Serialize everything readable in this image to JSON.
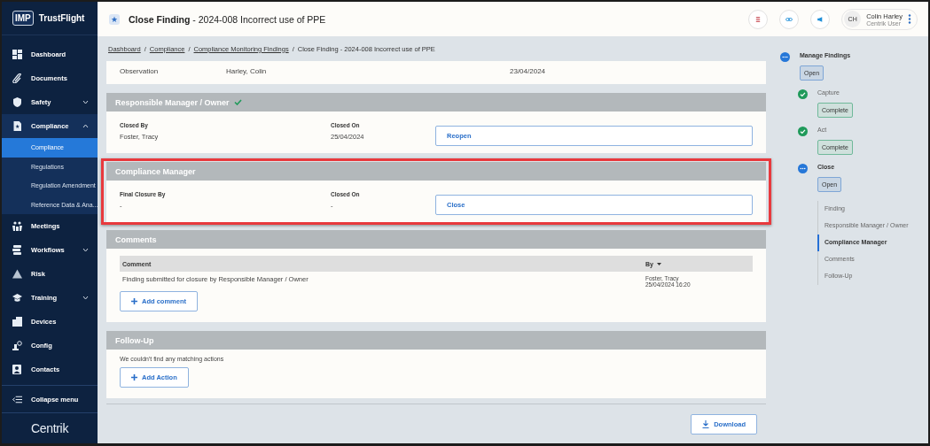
{
  "sidebar": {
    "brand": {
      "badge": "IMP",
      "name": "TrustFlight"
    },
    "items": [
      {
        "label": "Dashboard"
      },
      {
        "label": "Documents"
      },
      {
        "label": "Safety",
        "expanded": false
      },
      {
        "label": "Compliance",
        "expanded": true,
        "children": [
          {
            "label": "Compliance",
            "selected": true
          },
          {
            "label": "Regulations",
            "selected": false
          },
          {
            "label": "Regulation Amendment",
            "selected": false
          },
          {
            "label": "Reference Data & Ana...",
            "selected": false
          }
        ]
      },
      {
        "label": "Meetings"
      },
      {
        "label": "Workflows",
        "expanded": false
      },
      {
        "label": "Risk"
      },
      {
        "label": "Training",
        "expanded": false
      },
      {
        "label": "Devices"
      },
      {
        "label": "Config"
      },
      {
        "label": "Contacts"
      }
    ],
    "collapse": "Collapse menu",
    "footer_logo": "Centrik"
  },
  "header": {
    "title": "**Close Finding** - 2024-008 Incorrect use of PPE",
    "user": {
      "initials": "CH",
      "name": "Colin Harley",
      "role": "Centrik User"
    }
  },
  "breadcrumb": {
    "separator": "/",
    "links": [
      "Dashboard",
      "Compliance",
      "Compliance Monitoring Findings"
    ],
    "current": "Close Finding - 2024-008 Incorrect use of PPE"
  },
  "sections": [
    {
      "kind": "values",
      "values": [
        "Observation",
        "Harley, Colin",
        "23/04/2024"
      ]
    },
    {
      "kind": "closure",
      "title": "Responsible Manager / Owner",
      "completed": true,
      "highlighted": false,
      "fields": [
        {
          "label": "Closed By",
          "value": "Foster, Tracy"
        },
        {
          "label": "Closed On",
          "value": "25/04/2024"
        }
      ],
      "button": "Reopen"
    },
    {
      "kind": "closure",
      "title": "Compliance Manager",
      "completed": false,
      "highlighted": true,
      "fields": [
        {
          "label": "Final Closure By",
          "value": "-"
        },
        {
          "label": "Closed On",
          "value": "-"
        }
      ],
      "button": "Close"
    },
    {
      "kind": "comments",
      "title": "Comments",
      "columns": [
        "Comment",
        "By"
      ],
      "rows": [
        {
          "comment": "Finding submitted for closure by Responsible Manager / Owner",
          "by": "Foster, Tracy",
          "date": "25/04/2024 16:20"
        }
      ],
      "button": "Add comment"
    },
    {
      "kind": "followup",
      "title": "Follow-Up",
      "message": "We couldn't find any matching actions",
      "button": "Add Action"
    }
  ],
  "download": "Download",
  "workflow": {
    "root": {
      "label": "Manage Findings",
      "kind": "open",
      "badge": "Open"
    },
    "steps": [
      {
        "label": "Capture",
        "kind": "complete",
        "badge": "Complete"
      },
      {
        "label": "Act",
        "kind": "complete",
        "badge": "Complete"
      },
      {
        "label": "Close",
        "kind": "open",
        "badge": "Open"
      }
    ],
    "anchors": [
      {
        "label": "Finding",
        "selected": false
      },
      {
        "label": "Responsible Manager / Owner",
        "selected": false
      },
      {
        "label": "Compliance Manager",
        "selected": true
      },
      {
        "label": "Comments",
        "selected": false
      },
      {
        "label": "Follow-Up",
        "selected": false
      }
    ]
  }
}
